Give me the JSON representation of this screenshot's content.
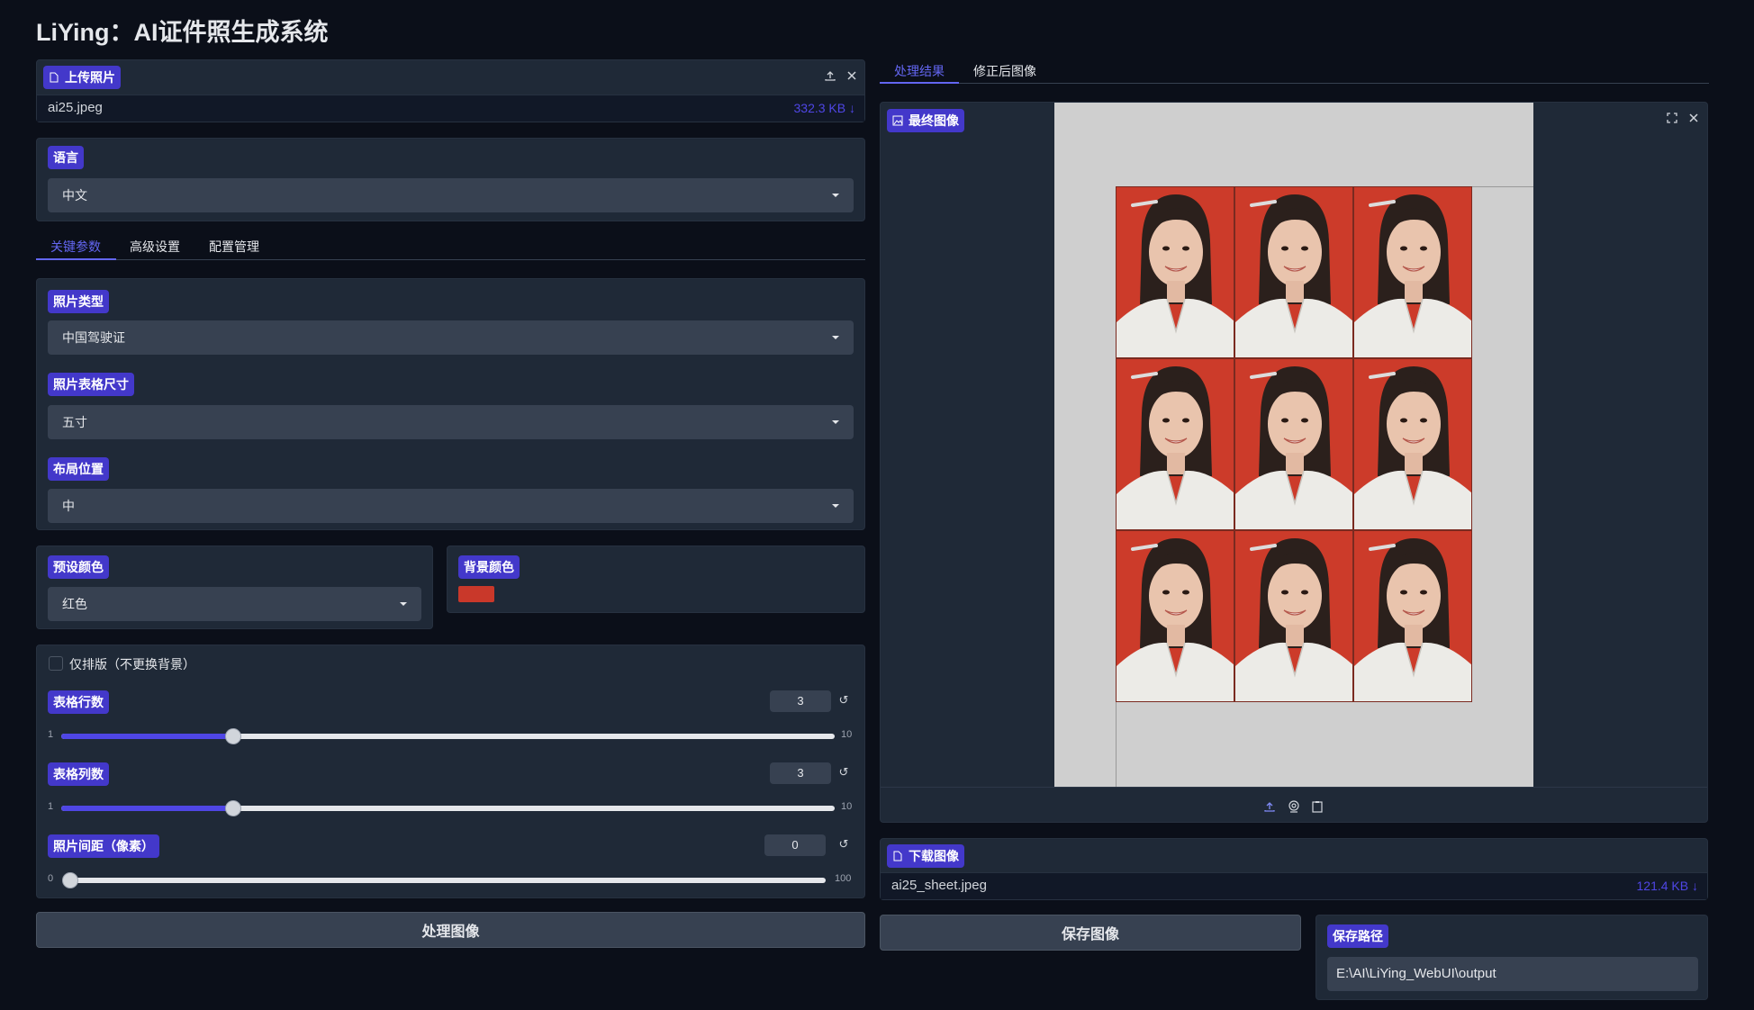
{
  "app": {
    "title": "LiYing：AI证件照生成系统"
  },
  "upload": {
    "label": "上传照片",
    "filename": "ai25.jpeg",
    "filesize": "332.3 KB ↓"
  },
  "language": {
    "label": "语言",
    "value": "中文"
  },
  "left_tabs": [
    "关键参数",
    "高级设置",
    "配置管理"
  ],
  "params": {
    "photo_type": {
      "label": "照片类型",
      "value": "中国驾驶证"
    },
    "sheet_size": {
      "label": "照片表格尺寸",
      "value": "五寸"
    },
    "layout": {
      "label": "布局位置",
      "value": "中"
    },
    "preset_color": {
      "label": "预设颜色",
      "value": "红色"
    },
    "bg_color": {
      "label": "背景颜色",
      "color": "#c9382a"
    }
  },
  "layout_only": {
    "label": "仅排版（不更换背景）",
    "checked": false
  },
  "sliders": [
    {
      "label": "表格行数",
      "value": "3",
      "min": "1",
      "max": "10",
      "fraction": 0.222
    },
    {
      "label": "表格列数",
      "value": "3",
      "min": "1",
      "max": "10",
      "fraction": 0.222
    },
    {
      "label": "照片间距（像素）",
      "value": "0",
      "min": "0",
      "max": "100",
      "fraction": 0
    }
  ],
  "buttons": {
    "process": "处理图像",
    "save": "保存图像"
  },
  "right_tabs": [
    "处理结果",
    "修正后图像"
  ],
  "final_image": {
    "label": "最终图像",
    "rows": 3,
    "cols": 3,
    "bg_color": "#cc3b2a"
  },
  "download": {
    "label": "下载图像",
    "filename": "ai25_sheet.jpeg",
    "filesize": "121.4 KB ↓"
  },
  "save_path": {
    "label": "保存路径",
    "value": "E:\\AI\\LiYing_WebUI\\output"
  },
  "icons": {
    "file": "file-icon",
    "upload": "upload-icon",
    "close": "close-icon",
    "image": "image-icon",
    "fullscreen": "fullscreen-icon",
    "webcam": "webcam-icon",
    "clipboard": "clipboard-icon",
    "reset": "reset-icon"
  }
}
